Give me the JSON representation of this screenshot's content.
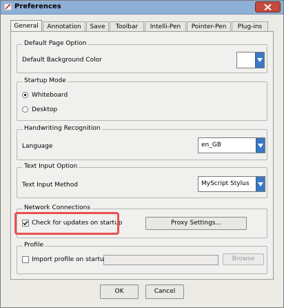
{
  "window": {
    "title": "Preferences",
    "tabs": [
      "General",
      "Annotation",
      "Save",
      "Toolbar",
      "Intelli-Pen",
      "Pointer-Pen",
      "Plug-ins"
    ],
    "active_tab": "General"
  },
  "default_page": {
    "group_title": "Default Page Option",
    "bg_color_label": "Default Background Color",
    "bg_color_value": "#ffffff"
  },
  "startup": {
    "group_title": "Startup Mode",
    "options": [
      "Whiteboard",
      "Desktop"
    ],
    "selected": "Whiteboard"
  },
  "handwriting": {
    "group_title": "Handwriting Recognition",
    "language_label": "Language",
    "language_value": "en_GB"
  },
  "text_input": {
    "group_title": "Text Input Option",
    "method_label": "Text Input Method",
    "method_value": "MyScript Stylus"
  },
  "network": {
    "group_title": "Network Connections",
    "check_updates_label": "Check for updates on startup",
    "check_updates_checked": true,
    "proxy_button": "Proxy Settings..."
  },
  "profile": {
    "group_title": "Profile",
    "import_label": "Import profile on startup",
    "import_checked": false,
    "path_value": "",
    "browse_button": "Browse"
  },
  "footer": {
    "ok": "OK",
    "cancel": "Cancel"
  },
  "colors": {
    "accent": "#3a78c4",
    "highlight": "#e8504f"
  }
}
